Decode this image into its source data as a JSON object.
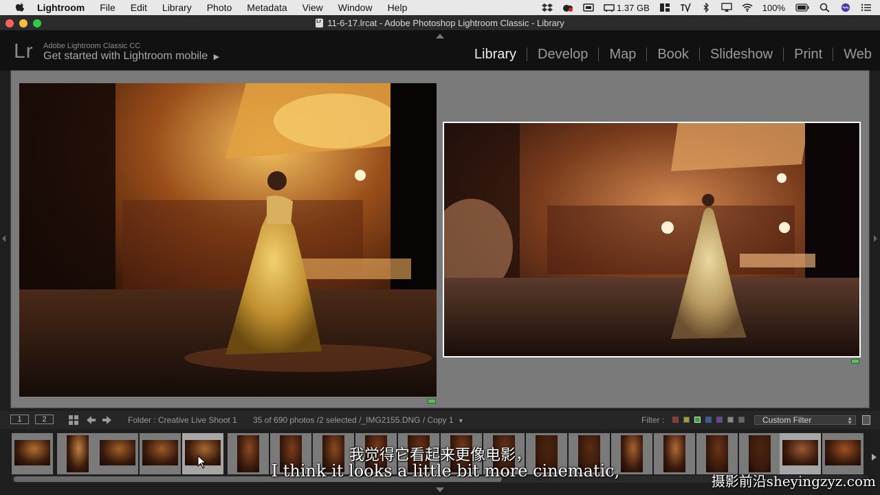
{
  "menubar": {
    "app_name": "Lightroom",
    "items": [
      "File",
      "Edit",
      "Library",
      "Photo",
      "Metadata",
      "View",
      "Window",
      "Help"
    ],
    "memory": "1.37 GB",
    "battery": "100%"
  },
  "window": {
    "title": "11-6-17.lrcat - Adobe Photoshop Lightroom Classic - Library"
  },
  "identity_plate": {
    "logo": "Lr",
    "product": "Adobe Lightroom Classic CC",
    "promo": "Get started with Lightroom mobile"
  },
  "modules": [
    "Library",
    "Develop",
    "Map",
    "Book",
    "Slideshow",
    "Print",
    "Web"
  ],
  "active_module": "Library",
  "toolbar": {
    "screen1": "1",
    "screen2": "2",
    "folder": "Folder : Creative Live Shoot 1",
    "status": "35 of 690 photos /2 selected /_IMG2155.DNG / Copy 1",
    "filter_label": "Filter :",
    "custom_filter": "Custom Filter"
  },
  "filter_colors": [
    "#a03030",
    "#a0a030",
    "#40a040",
    "#3060a0",
    "#7040a0",
    "#888888",
    "#666666"
  ],
  "subtitles": {
    "chinese": "我觉得它看起来更像电影，",
    "english": "I think it looks a little bit more cinematic,"
  },
  "watermark": "摄影前沿sheyingzyz.com"
}
